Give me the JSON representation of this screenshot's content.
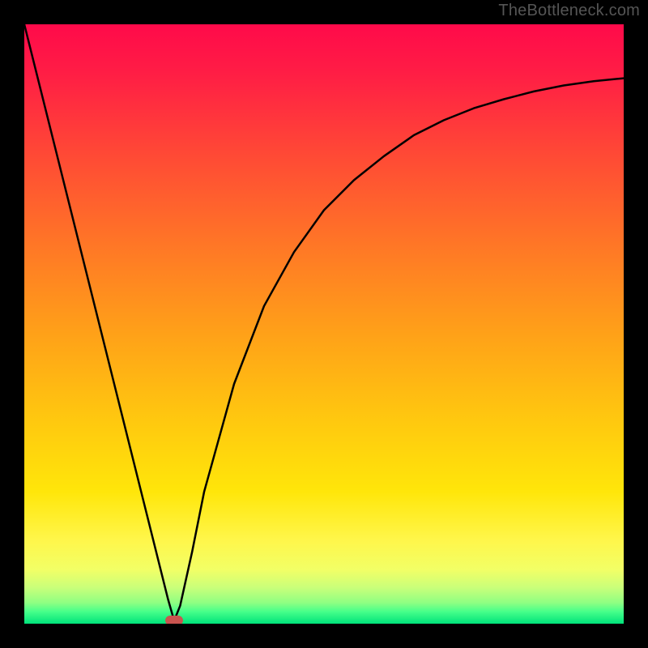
{
  "watermark": "TheBottleneck.com",
  "chart_data": {
    "type": "line",
    "title": "",
    "xlabel": "",
    "ylabel": "",
    "xlim": [
      0,
      100
    ],
    "ylim": [
      0,
      100
    ],
    "grid": false,
    "background": "vertical red→yellow→green gradient",
    "series": [
      {
        "name": "curve",
        "x": [
          0,
          5,
          10,
          15,
          20,
          24,
          25,
          26,
          28,
          30,
          35,
          40,
          45,
          50,
          55,
          60,
          65,
          70,
          75,
          80,
          85,
          90,
          95,
          100
        ],
        "values": [
          100,
          80,
          60,
          40,
          20,
          4,
          0.5,
          3,
          12,
          22,
          40,
          53,
          62,
          69,
          74,
          78,
          81.5,
          84,
          86,
          87.5,
          88.8,
          89.8,
          90.5,
          91
        ]
      }
    ],
    "marker": {
      "x": 25,
      "y": 0.5,
      "color": "#c9544f"
    }
  },
  "colors": {
    "frame": "#000000",
    "watermark": "#555555",
    "curve": "#000000",
    "marker": "#c9544f"
  }
}
